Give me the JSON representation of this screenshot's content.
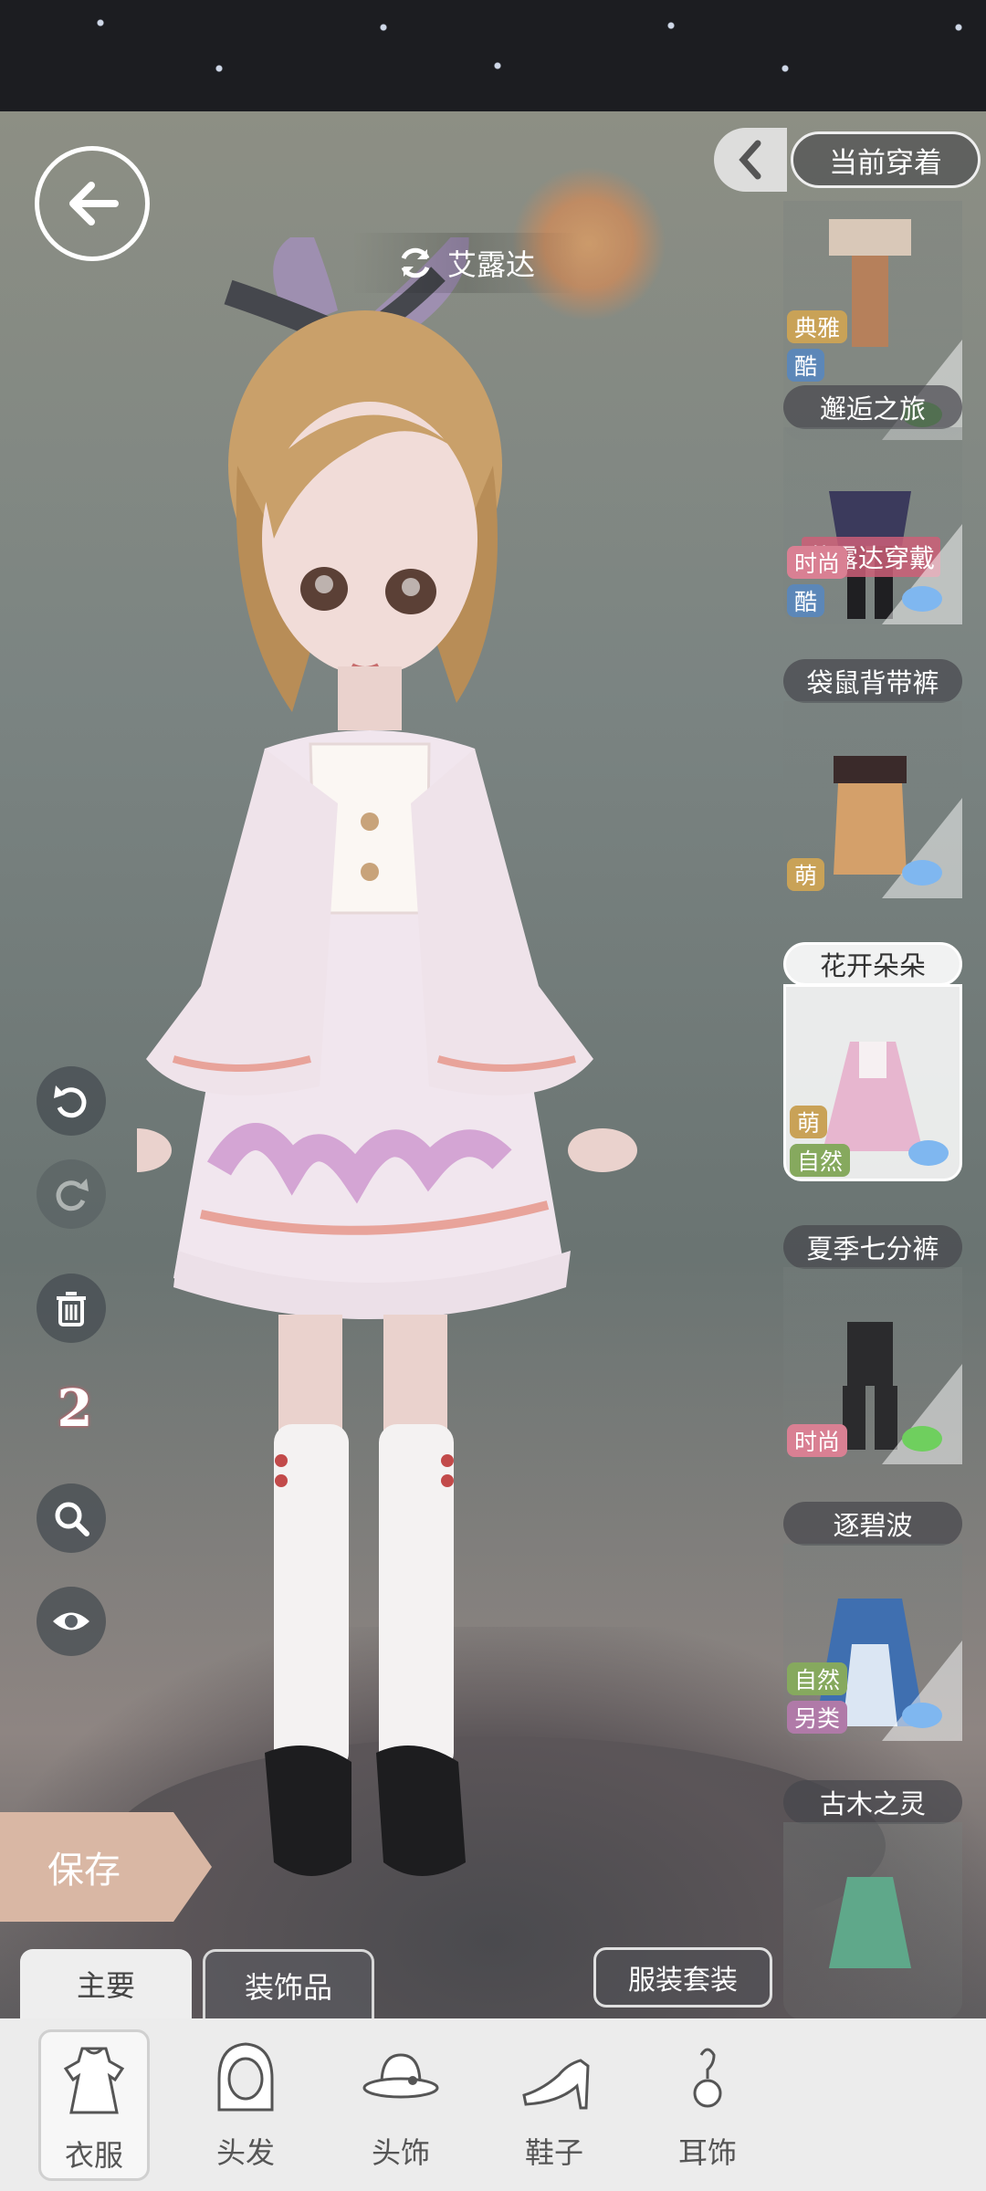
{
  "character": {
    "name": "艾露达"
  },
  "panel": {
    "current_wear_label": "当前穿着"
  },
  "outfits": [
    {
      "title": "",
      "tags": [
        {
          "text": "典雅",
          "color": "#c9a257"
        },
        {
          "text": "酷",
          "color": "#5c87b8"
        }
      ],
      "gem": "green"
    },
    {
      "title": "邂逅之旅",
      "tags": [
        {
          "text": "时尚",
          "color": "#d98093"
        },
        {
          "text": "酷",
          "color": "#5c87b8"
        }
      ],
      "wearing": "艾露达穿戴",
      "gem": "blue"
    },
    {
      "title": "袋鼠背带裤",
      "tags": [
        {
          "text": "萌",
          "color": "#c9a257"
        }
      ],
      "gem": "blue"
    },
    {
      "title": "花开朵朵",
      "tags": [
        {
          "text": "萌",
          "color": "#c9a257"
        },
        {
          "text": "自然",
          "color": "#86a95e"
        }
      ],
      "selected": true,
      "gem": "blue"
    },
    {
      "title": "夏季七分裤",
      "tags": [
        {
          "text": "时尚",
          "color": "#d98093"
        }
      ],
      "gem": "green"
    },
    {
      "title": "逐碧波",
      "tags": [
        {
          "text": "自然",
          "color": "#86a95e"
        },
        {
          "text": "另类",
          "color": "#b07aa8"
        }
      ],
      "gem": "blue"
    },
    {
      "title": "古木之灵",
      "tags": [],
      "gem": "none"
    }
  ],
  "toolbar": {
    "style_count": "2"
  },
  "save_label": "保存",
  "tabs": {
    "main": "主要",
    "accessories": "装饰品"
  },
  "outfit_set_label": "服装套装",
  "nav": {
    "clothes": "衣服",
    "hair": "头发",
    "headwear": "头饰",
    "shoes": "鞋子",
    "earrings": "耳饰"
  }
}
